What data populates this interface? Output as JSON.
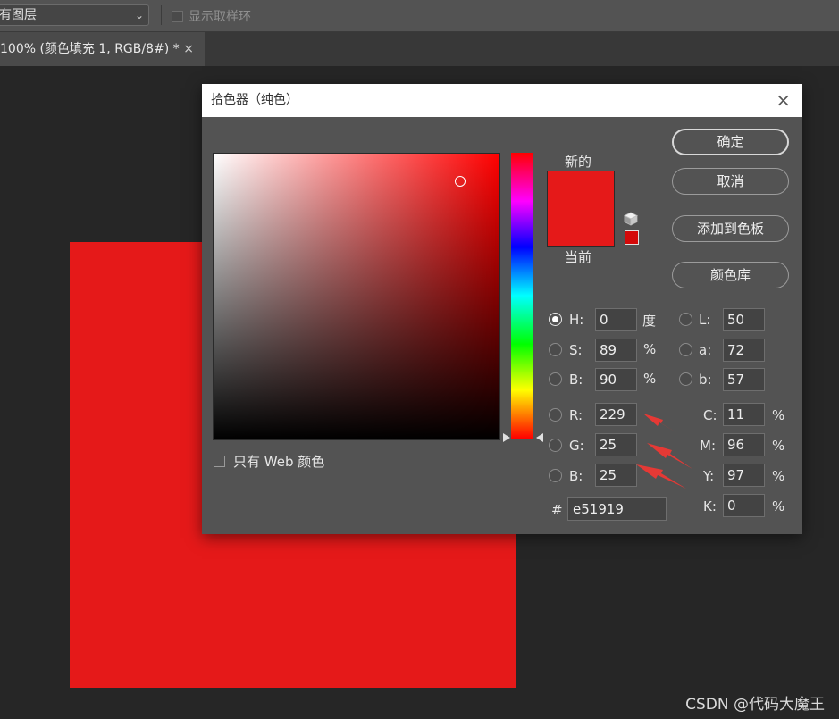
{
  "options_bar": {
    "layer_select_value": "有图层",
    "sample_ring_label": "显示取样环"
  },
  "document_tab": {
    "title": "100% (颜色填充 1, RGB/8#) *",
    "close_glyph": "×"
  },
  "canvas": {
    "fill_color": "#e51919"
  },
  "dialog": {
    "title": "拾色器（纯色）",
    "close_glyph": "×",
    "new_label": "新的",
    "current_label": "当前",
    "new_color": "#e51919",
    "current_color": "#e51919",
    "web_only_label": "只有 Web 颜色",
    "buttons": {
      "ok": "确定",
      "cancel": "取消",
      "add_swatch": "添加到色板",
      "color_library": "颜色库"
    },
    "hsb": {
      "h": {
        "label": "H:",
        "value": "0",
        "unit": "度",
        "selected": true
      },
      "s": {
        "label": "S:",
        "value": "89",
        "unit": "%"
      },
      "b": {
        "label": "B:",
        "value": "90",
        "unit": "%"
      }
    },
    "lab": {
      "l": {
        "label": "L:",
        "value": "50"
      },
      "a": {
        "label": "a:",
        "value": "72"
      },
      "b": {
        "label": "b:",
        "value": "57"
      }
    },
    "rgb": {
      "r": {
        "label": "R:",
        "value": "229"
      },
      "g": {
        "label": "G:",
        "value": "25"
      },
      "b": {
        "label": "B:",
        "value": "25"
      }
    },
    "cmyk": {
      "c": {
        "label": "C:",
        "value": "11",
        "unit": "%"
      },
      "m": {
        "label": "M:",
        "value": "96",
        "unit": "%"
      },
      "y": {
        "label": "Y:",
        "value": "97",
        "unit": "%"
      },
      "k": {
        "label": "K:",
        "value": "0",
        "unit": "%"
      }
    },
    "hex": {
      "label": "#",
      "value": "e51919"
    }
  },
  "watermark": "CSDN @代码大魔王",
  "colors": {
    "annotation_arrow": "#e53935",
    "accent_red": "#e51919"
  }
}
